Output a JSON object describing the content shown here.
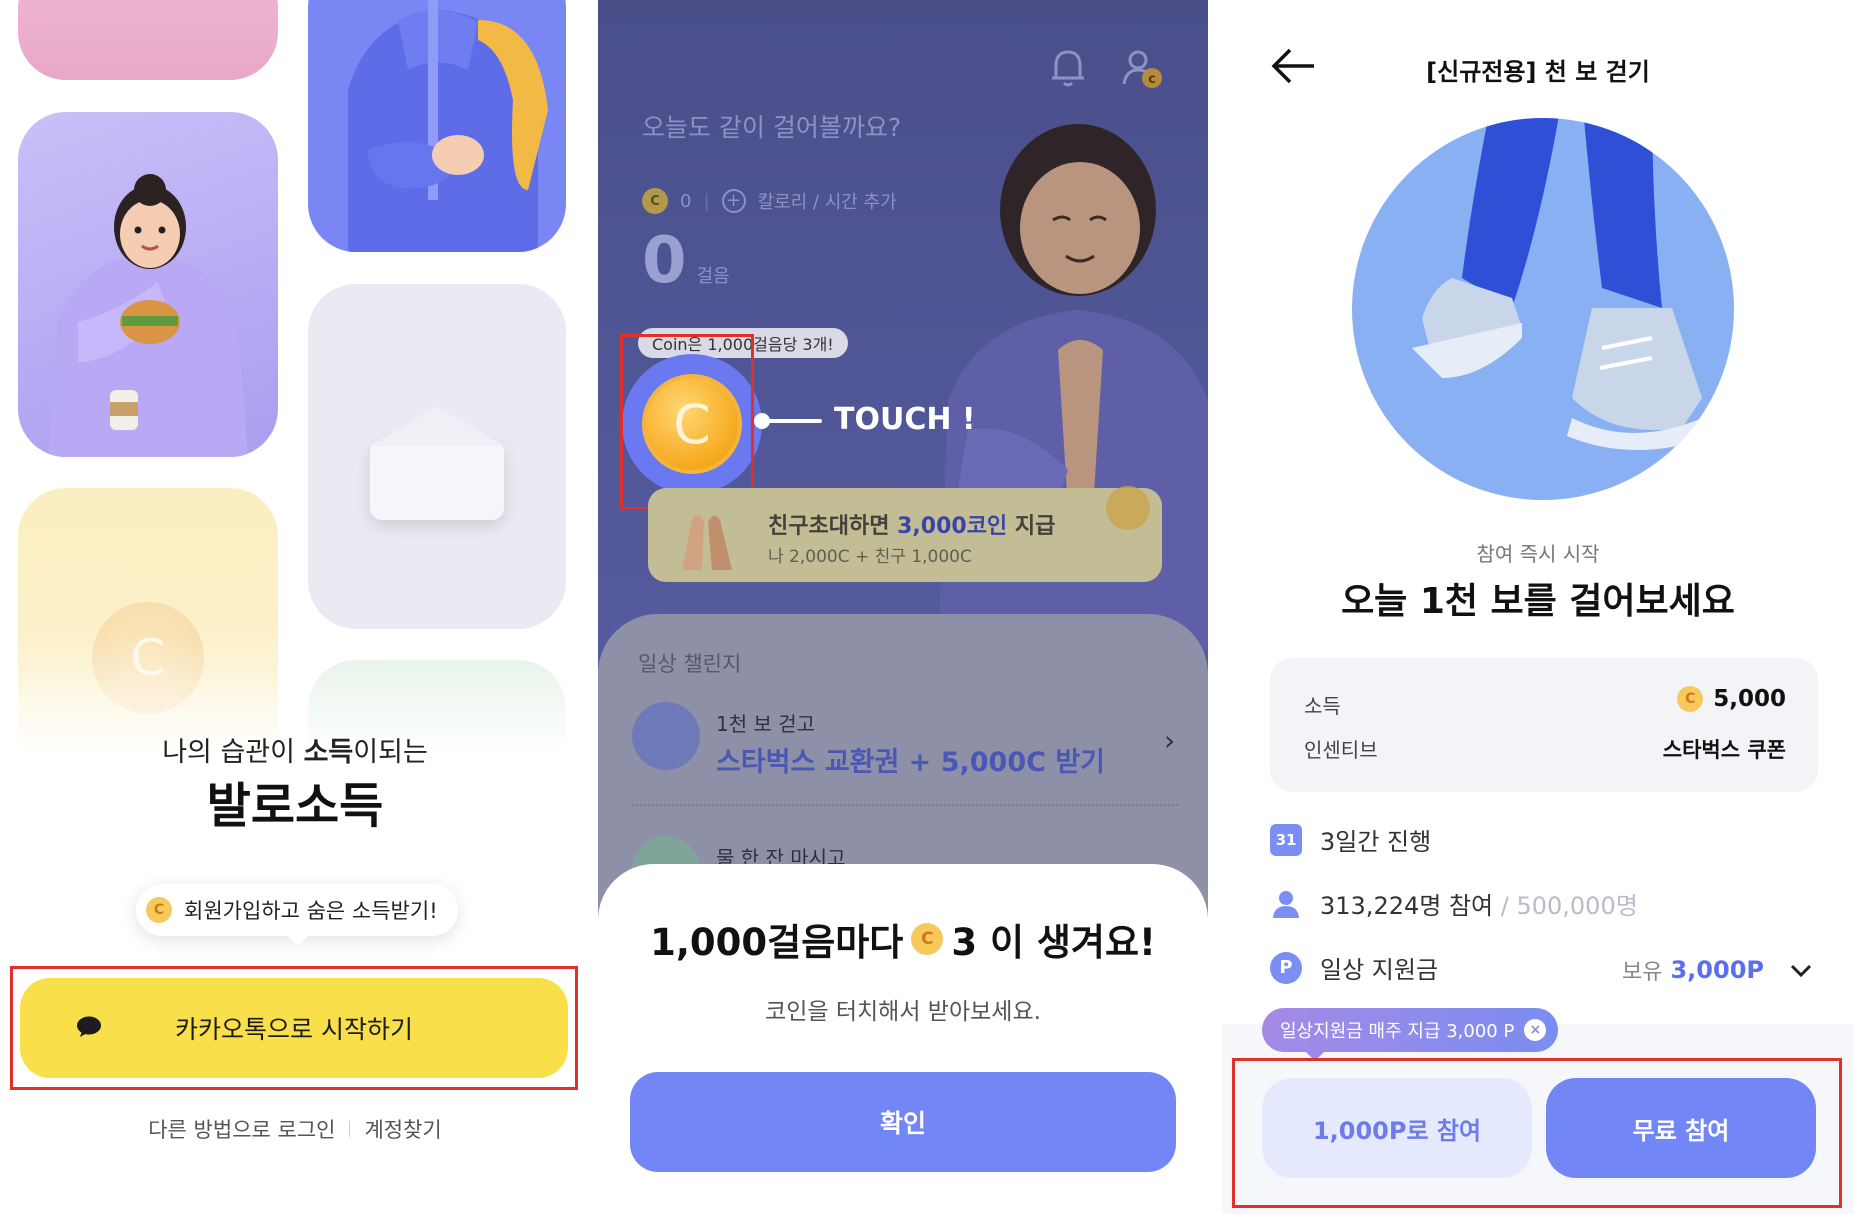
{
  "colors": {
    "accent": "#7386f5",
    "kakao_yellow": "#f9e04b",
    "highlight_red": "#e0302a",
    "coin_gold": "#f6a91e"
  },
  "screen1": {
    "tagline": {
      "part1": "나의 습관이 ",
      "emphasis": "소득",
      "part2": "이되는"
    },
    "brand": "발로소득",
    "tooltip": {
      "coin_glyph": "C",
      "text": "회원가입하고 숨은 소득받기!"
    },
    "kakao_button": "카카오톡으로 시작하기",
    "other_login": "다른 방법으로 로그인",
    "find_account": "계정찾기"
  },
  "screen2": {
    "question": "오늘도 같이 걸어볼까요?",
    "coin_glyph": "C",
    "coin_count": "0",
    "add_calorie": "칼로리 / 시간 추가",
    "steps": "0",
    "steps_unit": "걸음",
    "coin_pill": "Coin은 1,000걸음당 3개!",
    "big_coin_glyph": "C",
    "touch_label": "TOUCH !",
    "invite": {
      "title_pre": "친구초대하면 ",
      "title_highlight": "3,000코인",
      "title_post": " 지급",
      "subtitle": "나 2,000C + 친구 1,000C"
    },
    "challenge_section": "일상 챌린지",
    "challenges": [
      {
        "name": "1천 보 걷고",
        "reward": "스타벅스 교환권 + 5,000C 받기"
      },
      {
        "name": "물 한 잔 마시고"
      }
    ],
    "sheet": {
      "title_pre": "1,000걸음마다",
      "coin_glyph": "C",
      "title_post": "3 이 생겨요!",
      "subtitle": "코인을 터치해서 받아보세요.",
      "confirm": "확인"
    }
  },
  "screen3": {
    "title": "[신규전용] 천 보 걷기",
    "kicker": "참여 즉시 시작",
    "headline": "오늘 1천 보를 걸어보세요",
    "info": {
      "income_label": "소득",
      "income_coin_glyph": "C",
      "income_value": "5,000",
      "incentive_label": "인센티브",
      "incentive_value": "스타벅스 쿠폰"
    },
    "duration_icon_text": "31",
    "duration": "3일간 진행",
    "participants": "313,224명 참여",
    "participants_max": " / 500,000명",
    "support_icon_text": "P",
    "support_label": "일상 지원금",
    "hold_label": "보유",
    "hold_value": "3,000P",
    "promo": "일상지원금 매주 지급  3,000 P",
    "promo_close": "×",
    "btn_points": "1,000P로 참여",
    "btn_free": "무료 참여"
  }
}
